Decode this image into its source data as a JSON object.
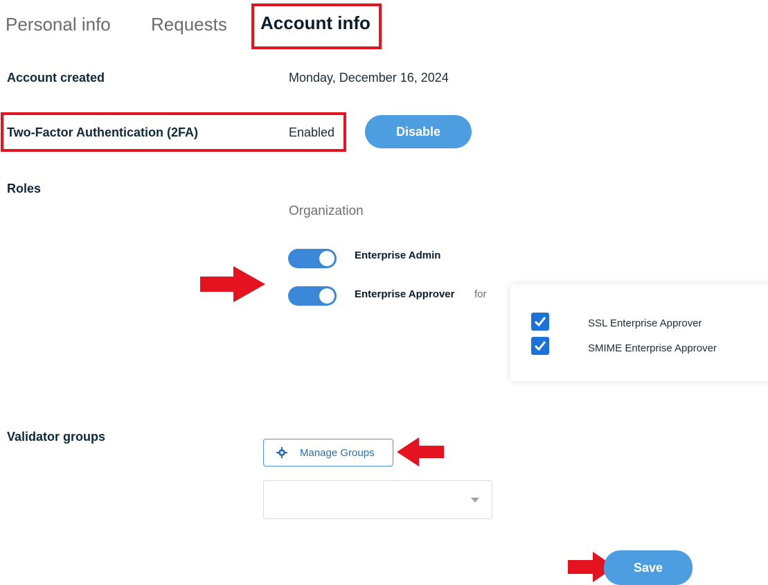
{
  "tabs": [
    {
      "label": "Personal info"
    },
    {
      "label": "Requests"
    },
    {
      "label": "Account info"
    }
  ],
  "account_created": {
    "label": "Account created",
    "value": "Monday, December 16, 2024"
  },
  "two_factor": {
    "label": "Two-Factor Authentication (2FA)",
    "status": "Enabled",
    "action_label": "Disable"
  },
  "roles": {
    "label": "Roles",
    "section_heading": "Organization",
    "items": [
      {
        "label": "Enterprise Admin",
        "enabled": true
      },
      {
        "label": "Enterprise Approver",
        "enabled": true,
        "suffix": "for"
      }
    ],
    "approver_scopes": [
      {
        "label": "SSL Enterprise Approver",
        "checked": true
      },
      {
        "label": "SMIME Enterprise Approver",
        "checked": true
      }
    ]
  },
  "validator_groups": {
    "label": "Validator groups",
    "manage_label": "Manage Groups",
    "select_value": ""
  },
  "save_label": "Save",
  "colors": {
    "accent": "#4c9ee0",
    "annotation_red": "#e3141f",
    "toggle_on": "#3b88d9",
    "checkbox": "#1a73d8"
  }
}
